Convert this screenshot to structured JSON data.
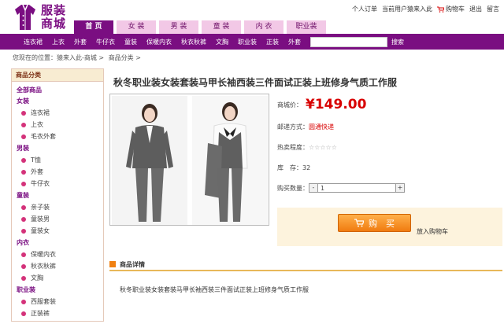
{
  "header": {
    "logo_text_line1": "服装",
    "logo_text_line2": "商城",
    "top_links": [
      "个人订单",
      "当前用户猿来入此",
      "购物车",
      "退出",
      "留言"
    ]
  },
  "main_nav": [
    "首 页",
    "女 装",
    "男 装",
    "童 装",
    "内 衣",
    "职业装"
  ],
  "sub_nav": [
    "连衣裙",
    "上衣",
    "外套",
    "牛仔衣",
    "童装",
    "保暖内衣",
    "秋衣秋裤",
    "文胸",
    "职业装",
    "正装",
    "外套"
  ],
  "search": {
    "placeholder": "",
    "button": "搜索"
  },
  "breadcrumb": [
    "您现在的位置：猿来入此-商城 >",
    "商品分类 >"
  ],
  "sidebar": {
    "title": "商品分类",
    "all": "全部商品",
    "categories": [
      {
        "name": "女装",
        "items": [
          "连衣裙",
          "上衣",
          "毛衣外套"
        ]
      },
      {
        "name": "男装",
        "items": [
          "T恤",
          "外套",
          "牛仔衣"
        ]
      },
      {
        "name": "童装",
        "items": [
          "亲子装",
          "童装男",
          "童装女"
        ]
      },
      {
        "name": "内衣",
        "items": [
          "保暖内衣",
          "秋衣秋裤",
          "文胸"
        ]
      },
      {
        "name": "职业装",
        "items": [
          "西服套装",
          "正装裤"
        ]
      }
    ]
  },
  "product": {
    "title": "秋冬职业装女装套装马甲长袖西装三件面试正装上班修身气质工作服",
    "price_label": "商城价：",
    "price": "¥149.00",
    "ship_label": "邮递方式：",
    "ship_value": "圆通快递",
    "hot_label": "热卖程度：",
    "hot_stars": "☆☆☆☆☆",
    "stock_label": "库　存：",
    "stock_value": "32",
    "qty_label": "购买数量：",
    "qty_minus": "-",
    "qty_value": "1",
    "qty_plus": "+",
    "buy_label": "购　买",
    "add_cart": "放入购物车"
  },
  "detail": {
    "title": "商品详情",
    "text": "秋冬职业装女装套装马甲长袖西装三件面试正装上班修身气质工作服"
  },
  "colors": {
    "brand": "#7a0e81",
    "tab": "#f2c8e6",
    "price": "#d80000",
    "accent": "#f07b10"
  }
}
